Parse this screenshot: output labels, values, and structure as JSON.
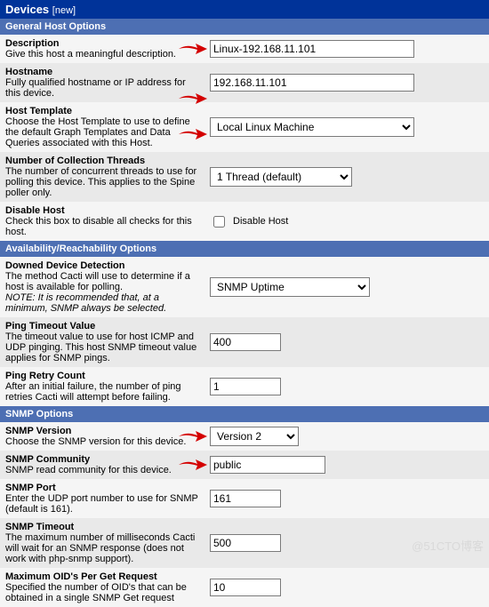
{
  "title": {
    "main": "Devices",
    "sub": "[new]"
  },
  "sections": {
    "general": "General Host Options",
    "avail": "Availability/Reachability Options",
    "snmp": "SNMP Options"
  },
  "fields": {
    "description": {
      "label": "Description",
      "help": "Give this host a meaningful description.",
      "value": "Linux-192.168.11.101"
    },
    "hostname": {
      "label": "Hostname",
      "help": "Fully qualified hostname or IP address for this device.",
      "value": "192.168.11.101"
    },
    "host_template": {
      "label": "Host Template",
      "help": "Choose the Host Template to use to define the default Graph Templates and Data Queries associated with this Host.",
      "value": "Local Linux Machine"
    },
    "threads": {
      "label": "Number of Collection Threads",
      "help": "The number of concurrent threads to use for polling this device. This applies to the Spine poller only.",
      "value": "1 Thread (default)"
    },
    "disable": {
      "label": "Disable Host",
      "help": "Check this box to disable all checks for this host.",
      "cblabel": "Disable Host"
    },
    "downed": {
      "label": "Downed Device Detection",
      "help": "The method Cacti will use to determine if a host is available for polling.",
      "note": "NOTE: It is recommended that, at a minimum, SNMP always be selected.",
      "value": "SNMP Uptime"
    },
    "ping_timeout": {
      "label": "Ping Timeout Value",
      "help": "The timeout value to use for host ICMP and UDP pinging. This host SNMP timeout value applies for SNMP pings.",
      "value": "400"
    },
    "ping_retry": {
      "label": "Ping Retry Count",
      "help": "After an initial failure, the number of ping retries Cacti will attempt before failing.",
      "value": "1"
    },
    "snmp_version": {
      "label": "SNMP Version",
      "help": "Choose the SNMP version for this device.",
      "value": "Version 2"
    },
    "snmp_community": {
      "label": "SNMP Community",
      "help": "SNMP read community for this device.",
      "value": "public"
    },
    "snmp_port": {
      "label": "SNMP Port",
      "help": "Enter the UDP port number to use for SNMP (default is 161).",
      "value": "161"
    },
    "snmp_timeout": {
      "label": "SNMP Timeout",
      "help": "The maximum number of milliseconds Cacti will wait for an SNMP response (does not work with php-snmp support).",
      "value": "500"
    },
    "max_oid": {
      "label": "Maximum OID's Per Get Request",
      "help": "Specified the number of OID's that can be obtained in a single SNMP Get request",
      "value": "10"
    }
  },
  "watermark": "@51CTO博客"
}
